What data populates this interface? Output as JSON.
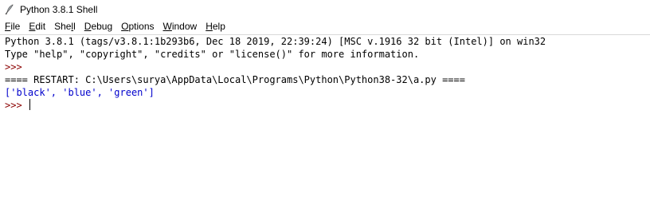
{
  "window": {
    "title": "Python 3.8.1 Shell"
  },
  "menu": [
    {
      "label_pre": "",
      "accel": "F",
      "label_post": "ile"
    },
    {
      "label_pre": "",
      "accel": "E",
      "label_post": "dit"
    },
    {
      "label_pre": "She",
      "accel": "l",
      "label_post": "l"
    },
    {
      "label_pre": "",
      "accel": "D",
      "label_post": "ebug"
    },
    {
      "label_pre": "",
      "accel": "O",
      "label_post": "ptions"
    },
    {
      "label_pre": "",
      "accel": "W",
      "label_post": "indow"
    },
    {
      "label_pre": "",
      "accel": "H",
      "label_post": "elp"
    }
  ],
  "shell": {
    "banner1": "Python 3.8.1 (tags/v3.8.1:1b293b6, Dec 18 2019, 22:39:24) [MSC v.1916 32 bit (Intel)] on win32",
    "banner2": "Type \"help\", \"copyright\", \"credits\" or \"license()\" for more information.",
    "prompt1": ">>> ",
    "restart": "==== RESTART: C:\\Users\\surya\\AppData\\Local\\Programs\\Python\\Python38-32\\a.py ====",
    "output": "['black', 'blue', 'green']",
    "prompt2": ">>> "
  },
  "colors": {
    "prompt": "#8b0000",
    "output": "#0000cc",
    "text": "#000000"
  },
  "icons": {
    "app": "python-feather-icon"
  }
}
